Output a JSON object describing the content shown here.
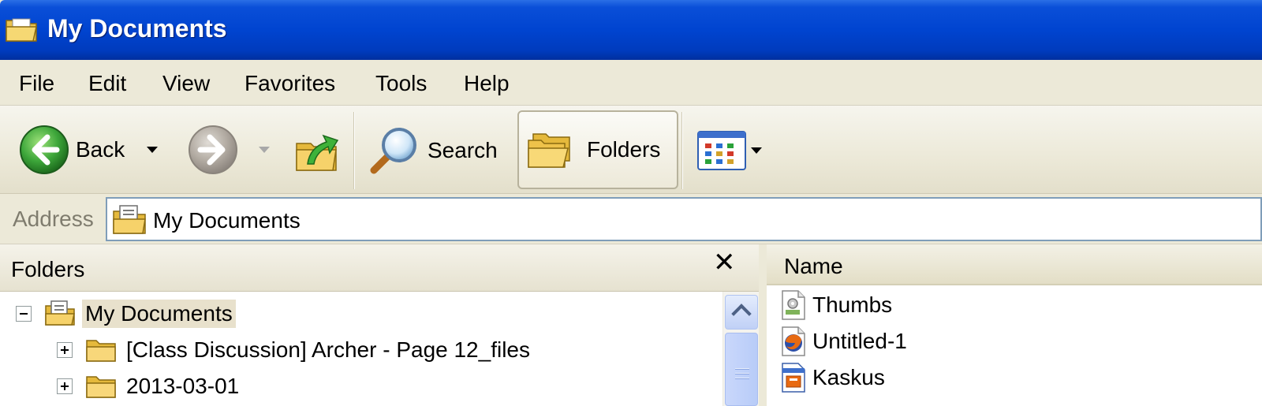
{
  "window": {
    "title": "My Documents"
  },
  "menu": {
    "items": [
      "File",
      "Edit",
      "View",
      "Favorites",
      "Tools",
      "Help"
    ]
  },
  "toolbar": {
    "back_label": "Back",
    "search_label": "Search",
    "folders_label": "Folders",
    "icons": [
      "back-arrow-icon",
      "forward-arrow-icon",
      "up-folder-icon",
      "search-magnifier-icon",
      "folders-icon",
      "views-icon"
    ]
  },
  "address": {
    "label": "Address",
    "value": "My Documents"
  },
  "folders_pane": {
    "title": "Folders",
    "close_glyph": "✕",
    "tree": [
      {
        "label": "My Documents",
        "expander": "minus",
        "selected": true
      },
      {
        "label": "[Class Discussion] Archer - Page 12_files",
        "expander": "plus"
      },
      {
        "label": "2013-03-01",
        "expander": "plus"
      }
    ]
  },
  "file_list": {
    "column_name": "Name",
    "files": [
      {
        "name": "Thumbs",
        "icon": "system-file-icon"
      },
      {
        "name": "Untitled-1",
        "icon": "firefox-html-icon"
      },
      {
        "name": "Kaskus",
        "icon": "web-document-icon"
      }
    ]
  },
  "colors": {
    "titlebar": "#0044d0",
    "chrome": "#ece9d8",
    "address_border": "#7f9db9",
    "selection": "#e8e1cc"
  }
}
